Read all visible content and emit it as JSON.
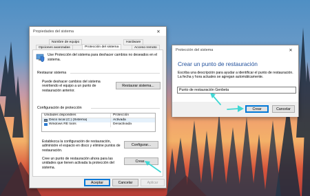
{
  "colors": {
    "accent": "#0078d7",
    "heading_blue": "#1f4e9a",
    "arrow_cyan": "#3fd7d4"
  },
  "props": {
    "title": "Propiedades del sistema",
    "close_glyph": "✕",
    "tabs": {
      "row1": [
        "Nombre de equipo",
        "Hardware"
      ],
      "row2": [
        "Opciones avanzadas",
        "Protección del sistema",
        "Acceso remoto"
      ]
    },
    "intro": "Use Protección del sistema para deshacer cambios no deseados en el sistema.",
    "restore_group": {
      "title": "Restaurar sistema",
      "text": "Puede deshacer cambios del sistema revirtiendo el equipo a un punto de restauración anterior.",
      "button": "Restaurar sistema..."
    },
    "config_group": {
      "title": "Configuración de protección",
      "table": {
        "headers": [
          "Unidades disponibles",
          "Protección"
        ],
        "rows": [
          {
            "drive": "Disco local (C:) (Sistema)",
            "status": "Activada"
          },
          {
            "drive": "Windows RE tools",
            "status": "Desactivada"
          }
        ]
      },
      "config_text": "Establezca la configuración de restauración, administre el espacio en disco y elimine puntos de restauración.",
      "config_button": "Configurar...",
      "create_text": "Cree un punto de restauración ahora para las unidades que tienen activada la protección del sistema.",
      "create_button": "Crear..."
    },
    "footer": {
      "ok": "Aceptar",
      "cancel": "Cancelar",
      "apply": "Aplicar"
    }
  },
  "restore_dialog": {
    "title": "Protección del sistema",
    "close_glyph": "✕",
    "heading": "Crear un punto de restauración",
    "description": "Escriba una descripción para ayudar a identificar el punto de restauración. La fecha y hora actuales se agregan automáticamente.",
    "input_value": "Punto de restauración Genbeta",
    "create_button": "Crear",
    "cancel_button": "Cancelar"
  }
}
